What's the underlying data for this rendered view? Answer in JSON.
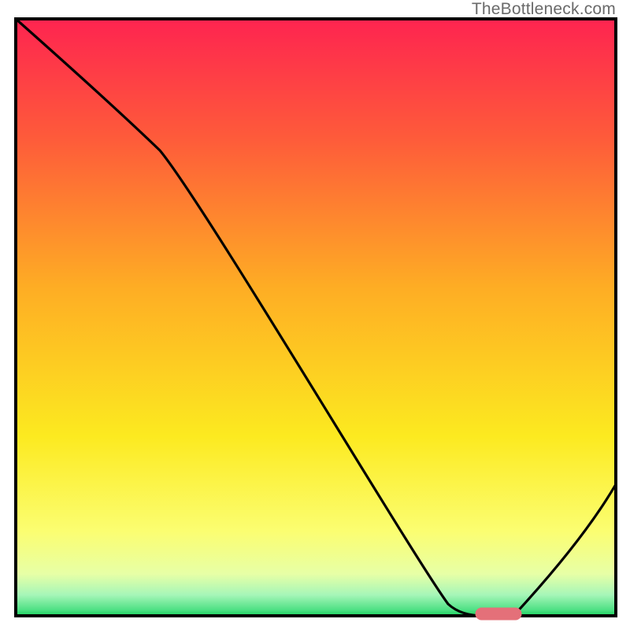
{
  "watermark": "TheBottleneck.com",
  "chart_data": {
    "type": "line",
    "title": "",
    "xlabel": "",
    "ylabel": "",
    "xlim": [
      0,
      100
    ],
    "ylim": [
      0,
      100
    ],
    "grid": false,
    "legend": false,
    "series": [
      {
        "name": "bottleneck-curve",
        "x": [
          0,
          24,
          72,
          78,
          83,
          100
        ],
        "y": [
          100,
          78,
          2,
          0,
          0,
          22
        ]
      }
    ],
    "marker": {
      "name": "optimal-range",
      "x_start": 77,
      "x_end": 84,
      "y": 0
    },
    "background_gradient": {
      "stops": [
        {
          "pct": 0.0,
          "color": "#fe2450"
        },
        {
          "pct": 0.2,
          "color": "#fe5b3a"
        },
        {
          "pct": 0.45,
          "color": "#fead24"
        },
        {
          "pct": 0.7,
          "color": "#fcea20"
        },
        {
          "pct": 0.86,
          "color": "#fbfe72"
        },
        {
          "pct": 0.93,
          "color": "#e7ffa6"
        },
        {
          "pct": 0.965,
          "color": "#a6f6b8"
        },
        {
          "pct": 0.99,
          "color": "#4ee084"
        },
        {
          "pct": 1.0,
          "color": "#1bcf5e"
        }
      ]
    },
    "colors": {
      "frame": "#000000",
      "curve": "#000000",
      "marker_fill": "#e47079",
      "marker_stroke": "#e47079"
    }
  }
}
